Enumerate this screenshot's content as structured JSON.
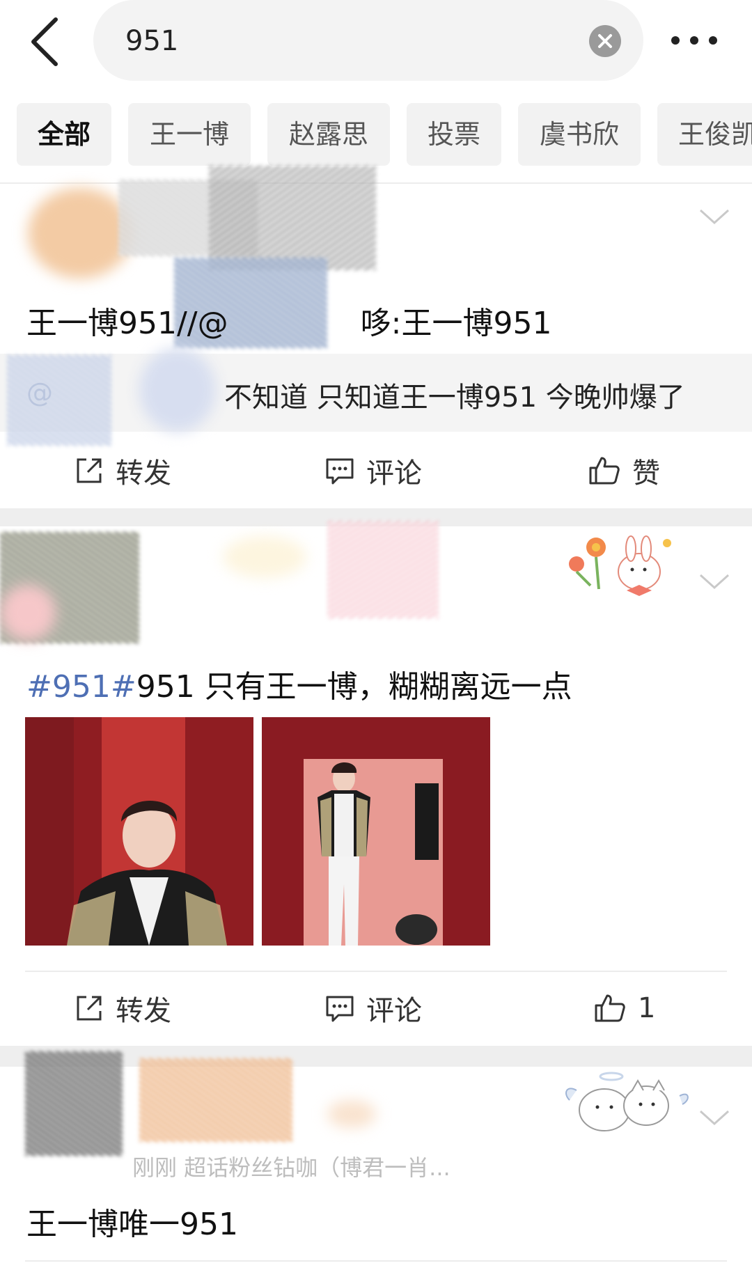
{
  "search": {
    "query": "951"
  },
  "tabs": [
    {
      "label": "全部",
      "active": true
    },
    {
      "label": "王一博"
    },
    {
      "label": "赵露思"
    },
    {
      "label": "投票"
    },
    {
      "label": "虞书欣"
    },
    {
      "label": "王俊凯"
    }
  ],
  "posts": [
    {
      "text": "王一博951//@",
      "text_tail": "哆:王一博951",
      "repost_prefix": "@",
      "repost_text": "不知道 只知道王一博951 今晚帅爆了",
      "actions": {
        "repost": "转发",
        "comment": "评论",
        "like": "赞"
      }
    },
    {
      "hashtag": "#951#",
      "text": "951 只有王一博，糊糊离远一点",
      "actions": {
        "repost": "转发",
        "comment": "评论",
        "like": "1"
      }
    },
    {
      "meta": "刚刚  超话粉丝钻咖（博君一肖...",
      "text": "王一博唯一951"
    }
  ],
  "colors": {
    "hashtag": "#4e6fb4",
    "separator": "#eeeeee",
    "background": "#ffffff"
  }
}
